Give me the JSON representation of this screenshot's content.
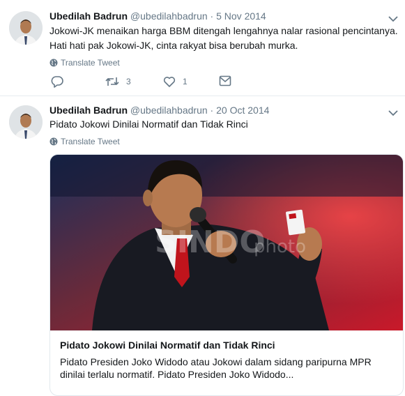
{
  "tweets": [
    {
      "author_name": "Ubedilah Badrun",
      "handle": "@ubedilahbadrun",
      "separator": " · ",
      "date": "5 Nov 2014",
      "text_line1": "Jokowi-JK menaikan harga BBM ditengah lengahnya nalar rasional pencintanya.",
      "text_line2": "Hati hati pak Jokowi-JK, cinta rakyat bisa berubah murka.",
      "translate_label": "Translate Tweet",
      "retweet_count": "3",
      "like_count": "1"
    },
    {
      "author_name": "Ubedilah Badrun",
      "handle": "@ubedilahbadrun",
      "separator": " · ",
      "date": "20 Oct 2014",
      "text_line1": "Pidato Jokowi Dinilai Normatif dan Tidak Rinci",
      "translate_label": "Translate Tweet",
      "card": {
        "title": "Pidato Jokowi Dinilai Normatif dan Tidak Rinci",
        "description_line1": "Pidato Presiden Joko Widodo atau Jokowi dalam sidang paripurna MPR",
        "description_line2": "dinilai terlalu normatif. Pidato Presiden Joko Widodo...",
        "watermark": "SINDO photo"
      }
    }
  ],
  "icons": {
    "reply": "reply-icon",
    "retweet": "retweet-icon",
    "like": "heart-icon",
    "dm": "mail-icon",
    "more": "chevron-down-icon",
    "translate": "globe-icon"
  },
  "colors": {
    "text_primary": "#14171a",
    "text_secondary": "#657786",
    "border": "#e6ecf0"
  }
}
